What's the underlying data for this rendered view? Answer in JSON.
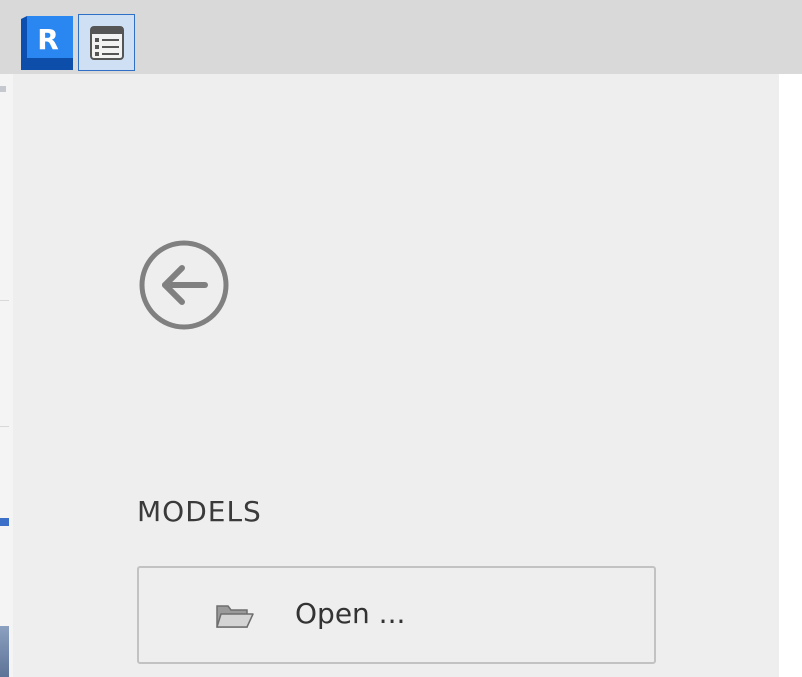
{
  "app": {
    "logo_letter": "R",
    "brand_color": "#1f6fd6"
  },
  "toolbar": {
    "quick_access_icon": "window-list-icon"
  },
  "navigation": {
    "back_icon": "back-arrow-circle-icon"
  },
  "models": {
    "section_title": "MODELS",
    "open_label": "Open ...",
    "open_icon": "folder-open-icon"
  }
}
